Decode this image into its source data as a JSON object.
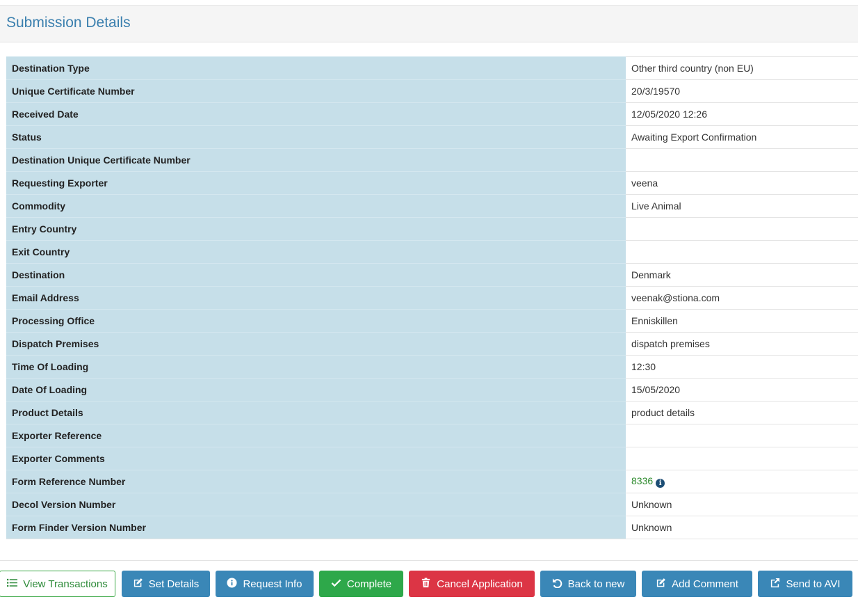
{
  "panel": {
    "title": "Submission Details"
  },
  "rows": [
    {
      "label": "Destination Type",
      "value": "Other third country (non EU)"
    },
    {
      "label": "Unique Certificate Number",
      "value": "20/3/19570"
    },
    {
      "label": "Received Date",
      "value": "12/05/2020 12:26"
    },
    {
      "label": "Status",
      "value": "Awaiting Export Confirmation"
    },
    {
      "label": "Destination Unique Certificate Number",
      "value": ""
    },
    {
      "label": "Requesting Exporter",
      "value": "veena"
    },
    {
      "label": "Commodity",
      "value": "Live Animal"
    },
    {
      "label": "Entry Country",
      "value": ""
    },
    {
      "label": "Exit Country",
      "value": ""
    },
    {
      "label": "Destination",
      "value": "Denmark"
    },
    {
      "label": "Email Address",
      "value": "veenak@stiona.com"
    },
    {
      "label": "Processing Office",
      "value": "Enniskillen"
    },
    {
      "label": "Dispatch Premises",
      "value": "dispatch premises"
    },
    {
      "label": "Time Of Loading",
      "value": "12:30"
    },
    {
      "label": "Date Of Loading",
      "value": "15/05/2020"
    },
    {
      "label": "Product Details",
      "value": "product details"
    },
    {
      "label": "Exporter Reference",
      "value": ""
    },
    {
      "label": "Exporter Comments",
      "value": ""
    },
    {
      "label": "Form Reference Number",
      "value": "8336"
    },
    {
      "label": "Decol Version Number",
      "value": "Unknown"
    },
    {
      "label": "Form Finder Version Number",
      "value": "Unknown"
    }
  ],
  "buttons": {
    "view_transactions": "View Transactions",
    "set_details": "Set Details",
    "request_info": "Request Info",
    "complete": "Complete",
    "cancel_application": "Cancel Application",
    "back_to_new": "Back to new",
    "add_comment": "Add Comment",
    "send_to_avi": "Send to AVI"
  },
  "icons": {
    "view_transactions": "list-icon",
    "set_details": "edit-icon",
    "request_info": "info-circle-icon",
    "complete": "check-icon",
    "cancel_application": "trash-icon",
    "back_to_new": "undo-icon",
    "add_comment": "edit-icon",
    "send_to_avi": "share-icon",
    "form_reference": "info-circle-icon"
  },
  "colors": {
    "header_title": "#3a7fae",
    "label_bg": "#c6dfe9",
    "btn_blue": "#3a87b7",
    "btn_green": "#2ea84a",
    "btn_red": "#dc3545",
    "link_green": "#2c8a2c"
  }
}
